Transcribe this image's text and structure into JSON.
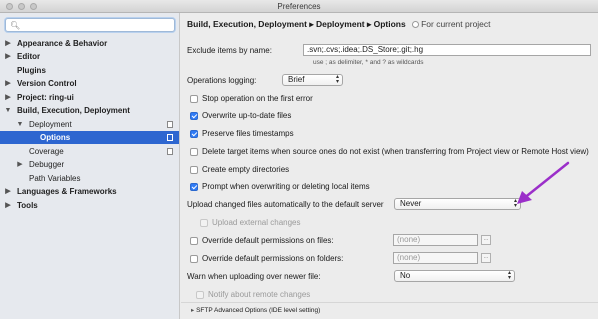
{
  "window": {
    "title": "Preferences"
  },
  "sidebar": {
    "search_placeholder": "",
    "items": [
      {
        "label": "Appearance & Behavior",
        "arrow": "▶"
      },
      {
        "label": "Editor",
        "arrow": "▶"
      },
      {
        "label": "Plugins",
        "arrow": ""
      },
      {
        "label": "Version Control",
        "arrow": "▶"
      },
      {
        "label": "Project: ring-ui",
        "arrow": "▶"
      },
      {
        "label": "Build, Execution, Deployment",
        "arrow": "▼"
      },
      {
        "label": "Deployment",
        "arrow": "▼"
      },
      {
        "label": "Options",
        "arrow": ""
      },
      {
        "label": "Coverage",
        "arrow": ""
      },
      {
        "label": "Debugger",
        "arrow": "▶"
      },
      {
        "label": "Path Variables",
        "arrow": ""
      },
      {
        "label": "Languages & Frameworks",
        "arrow": "▶"
      },
      {
        "label": "Tools",
        "arrow": "▶"
      }
    ]
  },
  "header": {
    "breadcrumb": "Build, Execution, Deployment ▸ Deployment ▸ Options",
    "project_note": "For current project"
  },
  "form": {
    "exclude_label": "Exclude items by name:",
    "exclude_value": ".svn;.cvs;.idea;.DS_Store;.git;.hg",
    "exclude_hint": "use ; as delimiter, * and ? as wildcards",
    "ops_logging_label": "Operations logging:",
    "ops_logging_value": "Brief",
    "checkboxes": [
      {
        "label": "Stop operation on the first error",
        "checked": false
      },
      {
        "label": "Overwrite up-to-date files",
        "checked": true
      },
      {
        "label": "Preserve files timestamps",
        "checked": true
      },
      {
        "label": "Delete target items when source ones do not exist (when transferring from Project view or Remote Host view)",
        "checked": false
      },
      {
        "label": "Create empty directories",
        "checked": false
      },
      {
        "label": "Prompt when overwriting or deleting local items",
        "checked": true
      }
    ],
    "upload_label": "Upload changed files automatically to the default server",
    "upload_value": "Never",
    "upload_external": "Upload external changes",
    "override_files_label": "Override default permissions on files:",
    "override_files_value": "(none)",
    "override_folders_label": "Override default permissions on folders:",
    "override_folders_value": "(none)",
    "warn_label": "Warn when uploading over newer file:",
    "warn_value": "No",
    "notify_label": "Notify about remote changes",
    "sftp_label": "SFTP Advanced Options (IDE level setting)",
    "dots": "..."
  },
  "colors": {
    "selection": "#2d66d0",
    "accent_arrow": "#9b2fc9"
  }
}
